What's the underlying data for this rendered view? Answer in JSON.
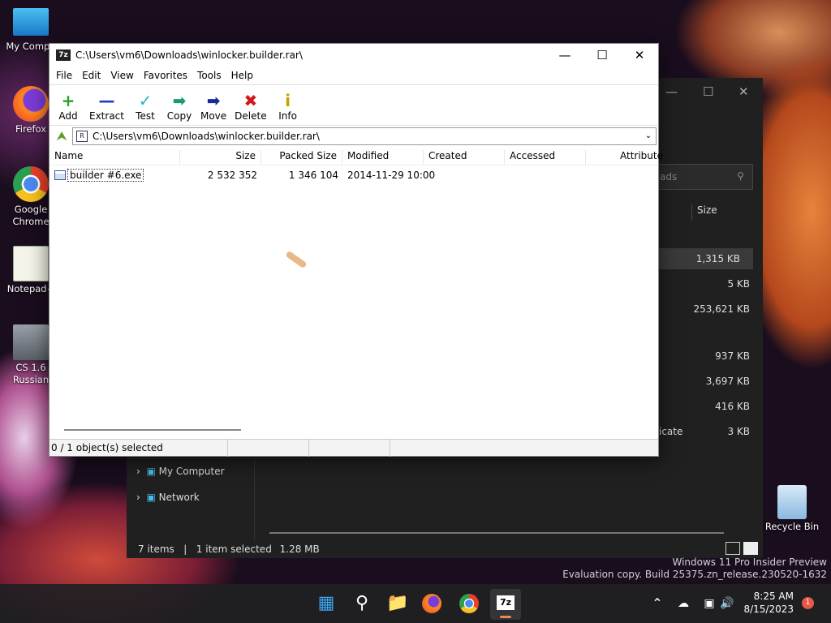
{
  "desktop": {
    "icons": [
      {
        "label": "My Compu"
      },
      {
        "label": "Firefox"
      },
      {
        "label": "Google Chrome"
      },
      {
        "label": "Notepad+"
      },
      {
        "label": "CS 1.6 Russian"
      }
    ],
    "recycle_bin": "Recycle Bin",
    "watermark1": "Windows 11 Pro Insider Preview",
    "watermark2": "Evaluation copy. Build 25375.zn_release.230520-1632"
  },
  "explorer": {
    "search_placeholder": "ads",
    "size_header": "Size",
    "sizes": [
      "1,315 KB",
      "5 KB",
      "253,621 KB",
      "937 KB",
      "3,697 KB",
      "416 KB",
      "3 KB"
    ],
    "partial_type": "icate",
    "nav": [
      {
        "label": "My Computer"
      },
      {
        "label": "Network"
      }
    ],
    "status_items": "7 items",
    "status_selected": "1 item selected",
    "status_size": "1.28 MB"
  },
  "sevenzip": {
    "title": "C:\\Users\\vm6\\Downloads\\winlocker.builder.rar\\",
    "menu": [
      "File",
      "Edit",
      "View",
      "Favorites",
      "Tools",
      "Help"
    ],
    "toolbar": [
      {
        "label": "Add",
        "icon": "+",
        "color": "#2aa02a"
      },
      {
        "label": "Extract",
        "icon": "—",
        "color": "#1a3ec8"
      },
      {
        "label": "Test",
        "icon": "✓",
        "color": "#20b8c0"
      },
      {
        "label": "Copy",
        "icon": "➡",
        "color": "#1a9a70"
      },
      {
        "label": "Move",
        "icon": "➡",
        "color": "#1a2a9a"
      },
      {
        "label": "Delete",
        "icon": "✖",
        "color": "#d01818"
      },
      {
        "label": "Info",
        "icon": "i",
        "color": "#c8a000"
      }
    ],
    "address": "C:\\Users\\vm6\\Downloads\\winlocker.builder.rar\\",
    "columns": [
      "Name",
      "Size",
      "Packed Size",
      "Modified",
      "Created",
      "Accessed",
      "Attribute"
    ],
    "file": {
      "name": "builder #6.exe",
      "size": "2 532 352",
      "packed": "1 346 104",
      "modified": "2014-11-29 10:00"
    },
    "status": "0 / 1 object(s) selected"
  },
  "taskbar": {
    "time": "8:25 AM",
    "date": "8/15/2023",
    "notifications": "1",
    "seven_zip_icon": "7z"
  }
}
